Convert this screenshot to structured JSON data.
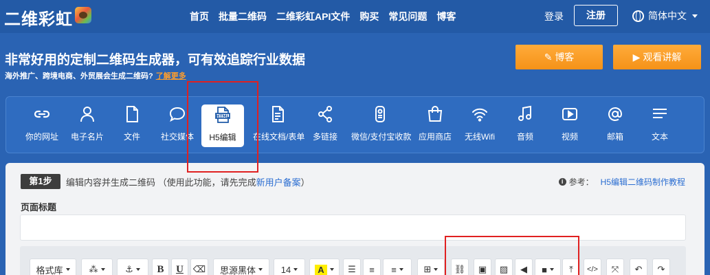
{
  "header": {
    "logo": "二维彩虹",
    "nav": [
      "首页",
      "批量二维码",
      "二维彩虹API文件",
      "购买",
      "常见问题",
      "博客"
    ],
    "login": "登录",
    "register": "注册",
    "language": "简体中文"
  },
  "hero": {
    "title": "非常好用的定制二维码生成器，可有效追踪行业数据",
    "subtitle": "海外推广、跨境电商、外贸展会生成二维码?",
    "learn_more": "了解更多",
    "blog_button": "博客",
    "video_button": "观看讲解"
  },
  "categories": [
    {
      "label": "你的网址",
      "icon": "link-icon"
    },
    {
      "label": "电子名片",
      "icon": "person-icon"
    },
    {
      "label": "文件",
      "icon": "file-icon"
    },
    {
      "label": "社交媒体",
      "icon": "chat-bubble-icon"
    },
    {
      "label": "H5编辑",
      "icon": "html-icon",
      "active": true
    },
    {
      "label": "在线文档/表单",
      "icon": "document-icon"
    },
    {
      "label": "多链接",
      "icon": "share-icon"
    },
    {
      "label": "微信/支付宝收款",
      "icon": "payment-icon"
    },
    {
      "label": "应用商店",
      "icon": "shopping-bag-icon"
    },
    {
      "label": "无线Wifi",
      "icon": "wifi-icon"
    },
    {
      "label": "音频",
      "icon": "music-icon"
    },
    {
      "label": "视频",
      "icon": "play-icon"
    },
    {
      "label": "邮箱",
      "icon": "at-icon"
    },
    {
      "label": "文本",
      "icon": "text-lines-icon"
    }
  ],
  "step": {
    "badge": "第1步",
    "text_before": "编辑内容并生成二维码 （使用此功能，请先完成",
    "link": "新用户备案",
    "text_after": "）",
    "ref_label": "参考：",
    "ref_link": "H5编辑二维码制作教程"
  },
  "form": {
    "page_title_label": "页面标题",
    "page_title_value": ""
  },
  "toolbar": {
    "format": "格式库",
    "font": "思源黑体",
    "size": "14",
    "bold": "B",
    "underline": "U",
    "highlight": "A"
  },
  "colors": {
    "background": "#2a63b3",
    "accent_orange": "#f59218",
    "highlight_red": "#e02020",
    "link_blue": "#2a6dd1"
  }
}
